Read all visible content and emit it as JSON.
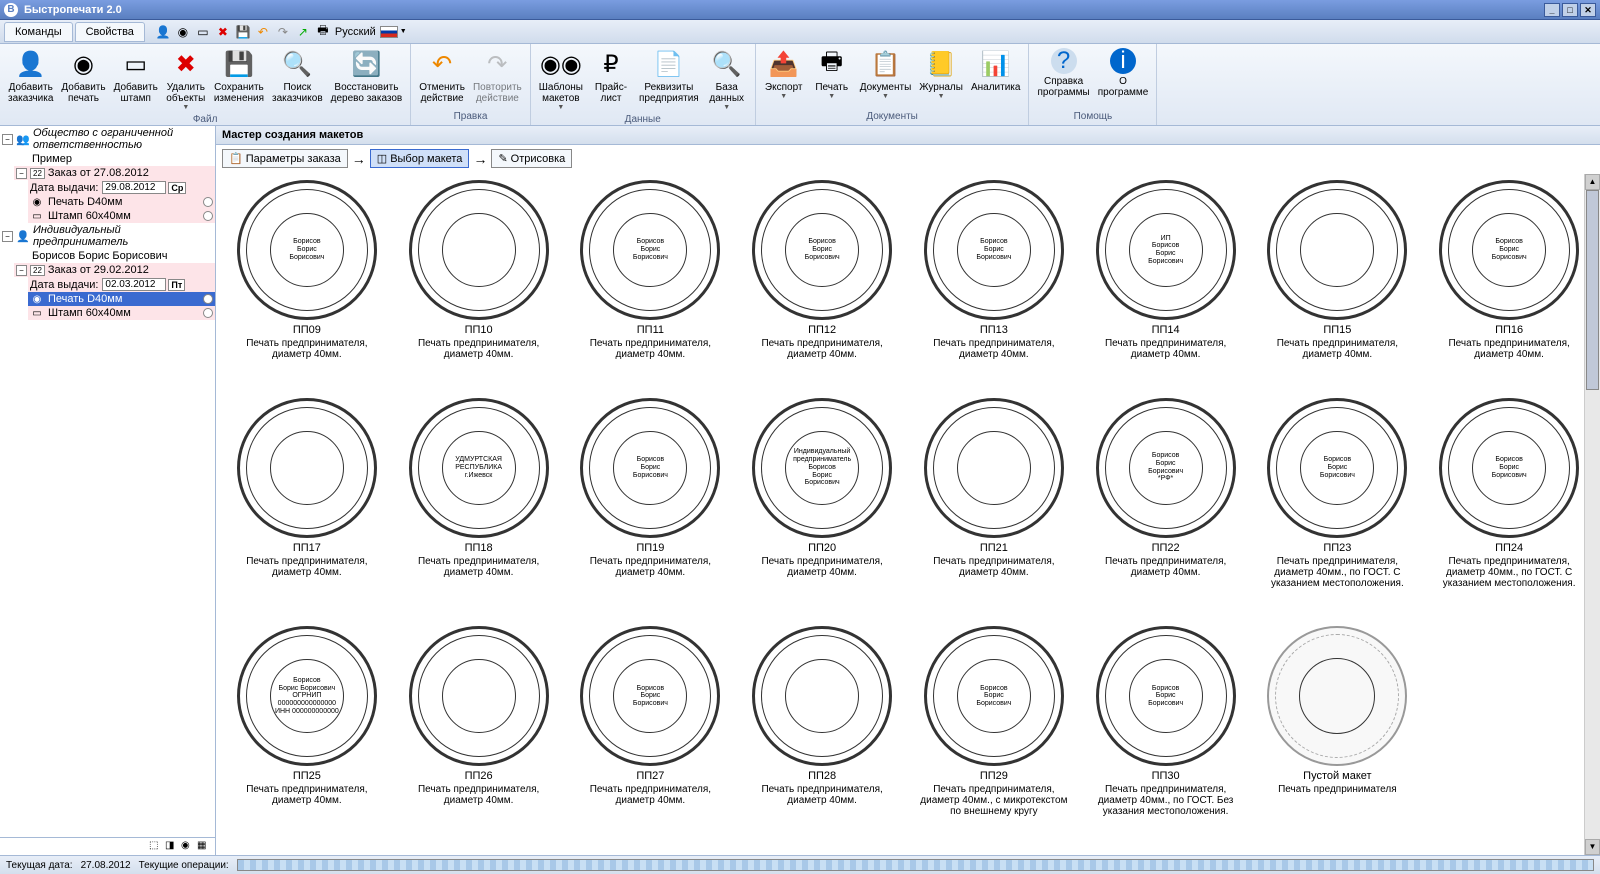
{
  "titlebar": {
    "title": "Быстропечати 2.0"
  },
  "menubar": {
    "tab_commands": "Команды",
    "tab_properties": "Свойства",
    "language": "Русский"
  },
  "ribbon": {
    "groups": [
      {
        "label": "Файл",
        "buttons": [
          {
            "label": "Добавить\nзаказчика"
          },
          {
            "label": "Добавить\nпечать"
          },
          {
            "label": "Добавить\nштамп"
          },
          {
            "label": "Удалить\nобъекты"
          },
          {
            "label": "Сохранить\nизменения"
          },
          {
            "label": "Поиск\nзаказчиков"
          },
          {
            "label": "Восстановить\nдерево заказов"
          }
        ]
      },
      {
        "label": "Правка",
        "buttons": [
          {
            "label": "Отменить\nдействие"
          },
          {
            "label": "Повторить\nдействие"
          }
        ]
      },
      {
        "label": "Данные",
        "buttons": [
          {
            "label": "Шаблоны\nмакетов"
          },
          {
            "label": "Прайс-\nлист"
          },
          {
            "label": "Реквизиты\nпредприятия"
          },
          {
            "label": "База\nданных"
          }
        ]
      },
      {
        "label": "Документы",
        "buttons": [
          {
            "label": "Экспорт"
          },
          {
            "label": "Печать"
          },
          {
            "label": "Документы"
          },
          {
            "label": "Журналы"
          },
          {
            "label": "Аналитика"
          }
        ]
      },
      {
        "label": "Помощь",
        "buttons": [
          {
            "label": "Справка\nпрограммы"
          },
          {
            "label": "О\nпрограмме"
          }
        ]
      }
    ]
  },
  "sidebar": {
    "org1": "Общество с ограниченной ответственностью",
    "org1_sample": "Пример",
    "order1": "Заказ от 27.08.2012",
    "order1_date_label": "Дата выдачи:",
    "order1_date": "29.08.2012",
    "order1_day": "Ср",
    "order1_item1": "Печать D40мм",
    "order1_item2": "Штамп 60х40мм",
    "org2": "Индивидуальный предприниматель",
    "org2_name": "Борисов Борис Борисович",
    "order2": "Заказ от 29.02.2012",
    "order2_date_label": "Дата выдачи:",
    "order2_date": "02.03.2012",
    "order2_day": "Пт",
    "order2_item1": "Печать D40мм",
    "order2_item2": "Штамп 60х40мм",
    "badge": "22"
  },
  "content": {
    "header": "Мастер создания макетов",
    "step1": "Параметры заказа",
    "step2": "Выбор макета",
    "step3": "Отрисовка"
  },
  "stamps": [
    {
      "code": "ПП09",
      "desc": "Печать предпринимателя, диаметр 40мм.",
      "inner": "Борисов\nБорис\nБорисович"
    },
    {
      "code": "ПП10",
      "desc": "Печать предпринимателя, диаметр 40мм.",
      "inner": ""
    },
    {
      "code": "ПП11",
      "desc": "Печать предпринимателя, диаметр 40мм.",
      "inner": "Борисов\nБорис\nБорисович"
    },
    {
      "code": "ПП12",
      "desc": "Печать предпринимателя, диаметр 40мм.",
      "inner": "Борисов\nБорис\nБорисович"
    },
    {
      "code": "ПП13",
      "desc": "Печать предпринимателя, диаметр 40мм.",
      "inner": "Борисов\nБорис\nБорисович"
    },
    {
      "code": "ПП14",
      "desc": "Печать предпринимателя, диаметр 40мм.",
      "inner": "ИП\nБорисов\nБорис\nБорисович"
    },
    {
      "code": "ПП15",
      "desc": "Печать предпринимателя, диаметр 40мм.",
      "inner": ""
    },
    {
      "code": "ПП16",
      "desc": "Печать предпринимателя, диаметр 40мм.",
      "inner": "Борисов\nБорис\nБорисович"
    },
    {
      "code": "ПП17",
      "desc": "Печать предпринимателя, диаметр 40мм.",
      "inner": ""
    },
    {
      "code": "ПП18",
      "desc": "Печать предпринимателя, диаметр 40мм.",
      "inner": "УДМУРТСКАЯ РЕСПУБЛИКА\nг.Ижевск"
    },
    {
      "code": "ПП19",
      "desc": "Печать предпринимателя, диаметр 40мм.",
      "inner": "Борисов\nБорис\nБорисович"
    },
    {
      "code": "ПП20",
      "desc": "Печать предпринимателя, диаметр 40мм.",
      "inner": "Индивидуальный\nпредприниматель\nБорисов\nБорис\nБорисович"
    },
    {
      "code": "ПП21",
      "desc": "Печать предпринимателя, диаметр 40мм.",
      "inner": ""
    },
    {
      "code": "ПП22",
      "desc": "Печать предпринимателя, диаметр 40мм.",
      "inner": "Борисов\nБорис\nБорисович\n*РФ*"
    },
    {
      "code": "ПП23",
      "desc": "Печать предпринимателя, диаметр 40мм., по ГОСТ. С указанием местоположения.",
      "inner": "Борисов\nБорис\nБорисович"
    },
    {
      "code": "ПП24",
      "desc": "Печать предпринимателя, диаметр 40мм., по ГОСТ. С указанием местоположения.",
      "inner": "Борисов\nБорис\nБорисович"
    },
    {
      "code": "ПП25",
      "desc": "Печать предпринимателя, диаметр 40мм.",
      "inner": "Борисов\nБорис Борисович\nОГРНИП 000000000000000\nИНН 000000000000"
    },
    {
      "code": "ПП26",
      "desc": "Печать предпринимателя, диаметр 40мм.",
      "inner": ""
    },
    {
      "code": "ПП27",
      "desc": "Печать предпринимателя, диаметр 40мм.",
      "inner": "Борисов\nБорис\nБорисович"
    },
    {
      "code": "ПП28",
      "desc": "Печать предпринимателя, диаметр 40мм.",
      "inner": ""
    },
    {
      "code": "ПП29",
      "desc": "Печать предпринимателя, диаметр 40мм., с микротекстом по внешнему кругу",
      "inner": "Борисов\nБорис\nБорисович"
    },
    {
      "code": "ПП30",
      "desc": "Печать предпринимателя, диаметр 40мм., по ГОСТ. Без указания местоположения.",
      "inner": "Борисов\nБорис\nБорисович"
    },
    {
      "code": "Пустой макет",
      "desc": "Печать предпринимателя",
      "inner": "",
      "empty": true
    }
  ],
  "statusbar": {
    "date_label": "Текущая дата:",
    "date": "27.08.2012",
    "ops_label": "Текущие операции:"
  }
}
